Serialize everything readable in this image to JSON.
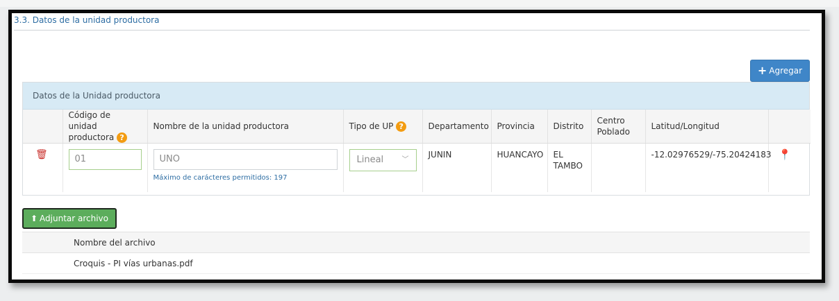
{
  "section": {
    "title": "3.3. Datos de la unidad productora"
  },
  "toolbar": {
    "agregar_label": "Agregar"
  },
  "table": {
    "caption": "Datos de la Unidad productora",
    "columns": [
      "Código de unidad productora",
      "Nombre de la unidad productora",
      "Tipo de UP",
      "Departamento",
      "Provincia",
      "Distrito",
      "Centro Poblado",
      "Latitud/Longitud"
    ],
    "rows": [
      {
        "codigo": "01",
        "nombre": "UNO",
        "nombre_hint": "Máximo de carácteres permitidos: 197",
        "tipo": "Lineal",
        "departamento": "JUNIN",
        "provincia": "HUANCAYO",
        "distrito": "EL TAMBO",
        "centro_poblado": "",
        "latlong": "-12.02976529/-75.20424183"
      }
    ]
  },
  "attachments": {
    "button_label": "Adjuntar archivo",
    "header": "Nombre del archivo",
    "files": [
      "Croquis - PI vías urbanas.pdf"
    ]
  },
  "icons": {
    "help": "?",
    "accent": "#3f86c8",
    "success": "#5cad5c",
    "danger": "#c9302c",
    "warning": "#f39c12"
  }
}
